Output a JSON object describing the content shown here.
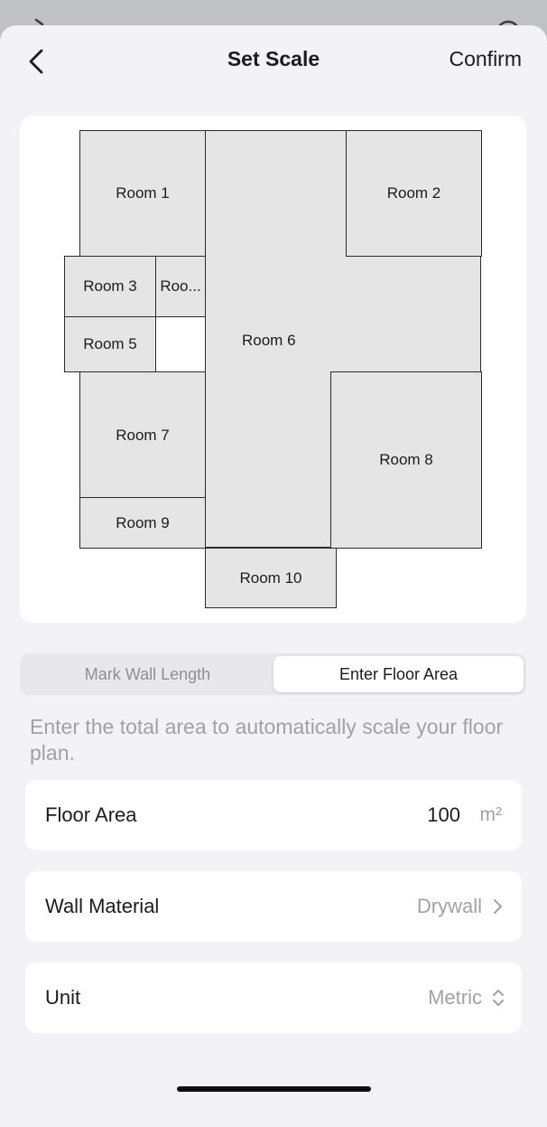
{
  "nav": {
    "title": "Set Scale",
    "confirm_label": "Confirm",
    "back_icon": "chevron-left-icon"
  },
  "floor_plan": {
    "rooms": [
      {
        "key": "room1",
        "label": "Room 1"
      },
      {
        "key": "room2",
        "label": "Room 2"
      },
      {
        "key": "room3",
        "label": "Room 3"
      },
      {
        "key": "room4",
        "label": "Roo..."
      },
      {
        "key": "room5",
        "label": "Room 5"
      },
      {
        "key": "room6",
        "label": "Room 6"
      },
      {
        "key": "room7",
        "label": "Room 7"
      },
      {
        "key": "room8",
        "label": "Room 8"
      },
      {
        "key": "room9",
        "label": "Room 9"
      },
      {
        "key": "room10",
        "label": "Room 10"
      }
    ],
    "colors": {
      "room_fill": "#e5e5e5",
      "wall": "#2b2b2b"
    }
  },
  "segmented": {
    "options": [
      "Mark Wall Length",
      "Enter Floor Area"
    ],
    "selected": "Enter Floor Area"
  },
  "hint": "Enter the total area to automatically scale your floor plan.",
  "fields": {
    "floor_area": {
      "label": "Floor Area",
      "value": "100",
      "unit": "m²"
    },
    "wall_material": {
      "label": "Wall Material",
      "value": "Drywall",
      "icon": "chevron-right-icon"
    },
    "unit": {
      "label": "Unit",
      "value": "Metric",
      "icon": "chevron-up-down-icon"
    }
  }
}
